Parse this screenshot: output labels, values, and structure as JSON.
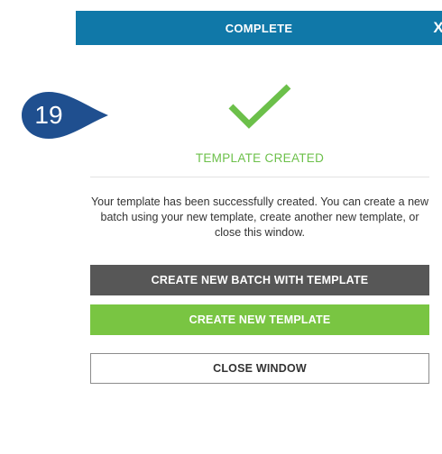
{
  "header": {
    "title": "COMPLETE",
    "close_glyph": "X"
  },
  "step_badge": {
    "number": "19",
    "color": "#1f4f8f"
  },
  "status": {
    "icon": "checkmark-icon",
    "title": "TEMPLATE CREATED",
    "color": "#6cc04a"
  },
  "message": "Your template has been successfully created. You can create a new batch using your new template, create another new template, or close this window.",
  "buttons": {
    "create_batch": "CREATE NEW BATCH WITH TEMPLATE",
    "create_template": "CREATE NEW TEMPLATE",
    "close_window": "CLOSE WINDOW"
  }
}
